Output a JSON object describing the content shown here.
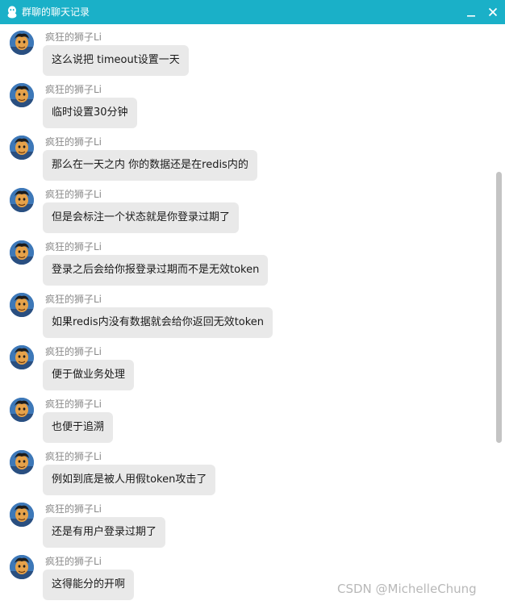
{
  "window": {
    "title": "群聊的聊天记录",
    "title_icon": "qq-penguin-icon",
    "minimize_icon": "minimize-icon",
    "close_icon": "close-icon",
    "accent_color": "#1ab0c8"
  },
  "messages": [
    {
      "sender": "疯狂的狮子Li",
      "text": "这么说把 timeout设置一天"
    },
    {
      "sender": "疯狂的狮子Li",
      "text": "临时设置30分钟"
    },
    {
      "sender": "疯狂的狮子Li",
      "text": "那么在一天之内 你的数据还是在redis内的"
    },
    {
      "sender": "疯狂的狮子Li",
      "text": "但是会标注一个状态就是你登录过期了"
    },
    {
      "sender": "疯狂的狮子Li",
      "text": "登录之后会给你报登录过期而不是无效token"
    },
    {
      "sender": "疯狂的狮子Li",
      "text": "如果redis内没有数据就会给你返回无效token"
    },
    {
      "sender": "疯狂的狮子Li",
      "text": "便于做业务处理"
    },
    {
      "sender": "疯狂的狮子Li",
      "text": "也便于追溯"
    },
    {
      "sender": "疯狂的狮子Li",
      "text": "例如到底是被人用假token攻击了"
    },
    {
      "sender": "疯狂的狮子Li",
      "text": "还是有用户登录过期了"
    },
    {
      "sender": "疯狂的狮子Li",
      "text": "这得能分的开啊"
    }
  ],
  "watermark": "CSDN @MichelleChung"
}
